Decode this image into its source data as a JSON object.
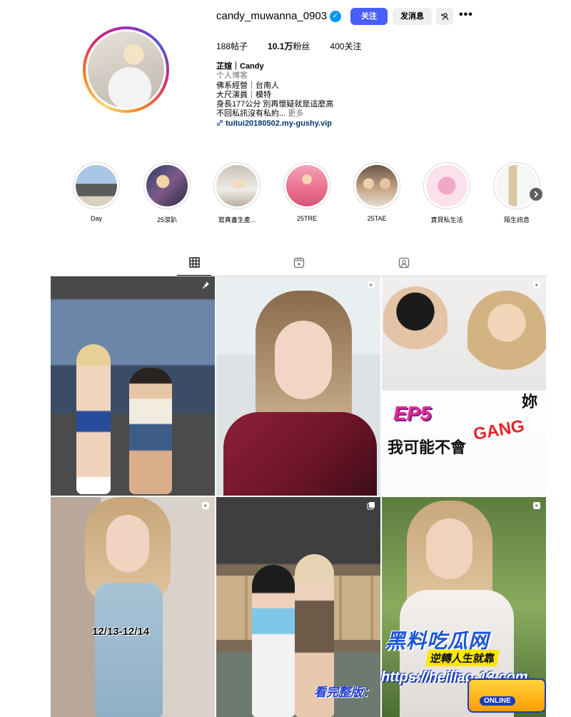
{
  "profile": {
    "username": "candy_muwanna_0903",
    "verified_mark": "✓",
    "follow_label": "关注",
    "message_label": "发消息",
    "suggest_icon_glyph": "+⁠👤",
    "more_glyph": "•••",
    "stats": {
      "posts_count": "188",
      "posts_label": "帖子",
      "followers_count": "10.1万",
      "followers_label": "粉丝",
      "following_count": "400",
      "following_label": "关注"
    },
    "bio": {
      "name": "芷媗｜Candy",
      "category": "个人博客",
      "lines": [
        "佛系經營｜台南人",
        "大尺演員｜模特",
        "身長177公分 別再懷疑就是這麼高",
        "不回私訊沒有私約..."
      ],
      "more_label": "更多",
      "link": "tuitui20180502.my-gushy.vip"
    }
  },
  "highlights": [
    {
      "label": "Day"
    },
    {
      "label": "25滾趴"
    },
    {
      "label": "寫真書生產..."
    },
    {
      "label": "25TRE"
    },
    {
      "label": "25TAE"
    },
    {
      "label": "寶貝私生活"
    },
    {
      "label": "陌生訊息"
    }
  ],
  "tabs": [
    "posts",
    "reels",
    "tagged"
  ],
  "posts": {
    "p3_title": "EP5",
    "p3_line1": "我可能不會",
    "p3_line2": "GANG",
    "p3_line3": "妳",
    "p4_date": "12/13-12/14"
  },
  "watermark": {
    "brand": "黑料吃瓜网",
    "slogan": "逆轉人生就靠",
    "url": "https://heiliao-13.com",
    "full_label": "看完整版：",
    "logo_label": "ONLINE"
  },
  "colors": {
    "accent": "#4a5df9",
    "verified": "#0095f6",
    "link": "#00376b",
    "muted": "#737373"
  }
}
